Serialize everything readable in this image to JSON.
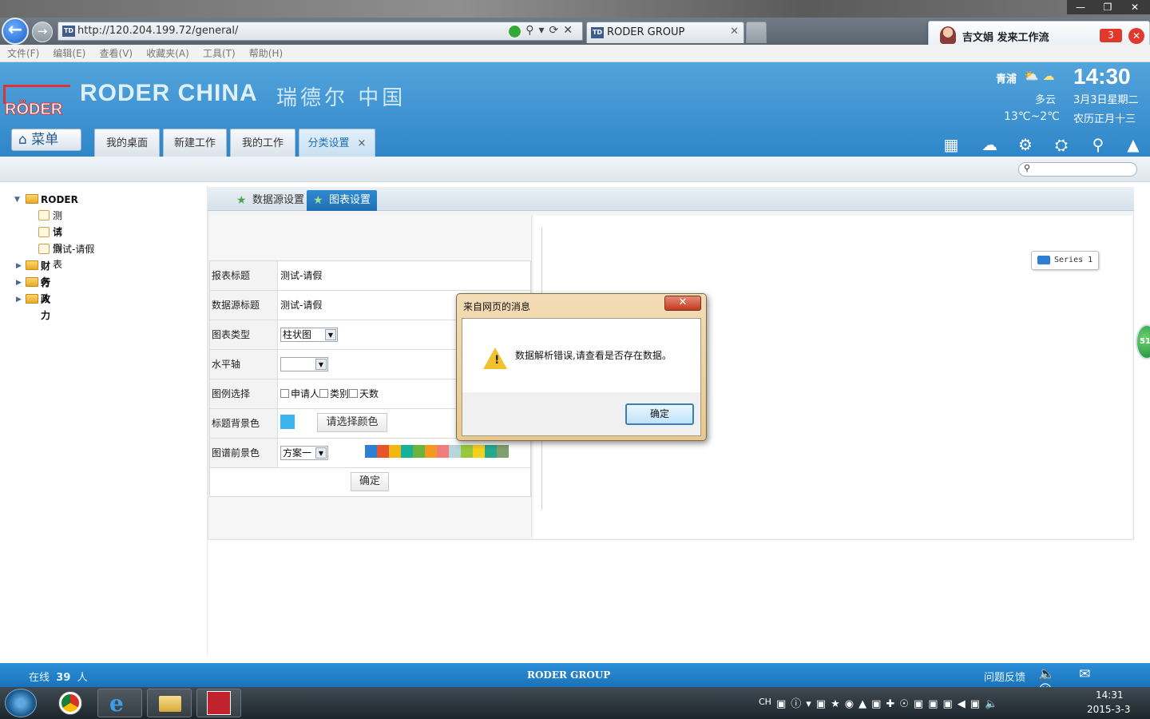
{
  "browser": {
    "url": "http://120.204.199.72/general/",
    "tab_title": "RODER GROUP",
    "favicon_label": "TD",
    "menu": [
      "文件(F)",
      "编辑(E)",
      "查看(V)",
      "收藏夹(A)",
      "工具(T)",
      "帮助(H)"
    ]
  },
  "notification": {
    "text": "吉文娟  发来工作流",
    "count": "3"
  },
  "header": {
    "logo_text": "RÖDER",
    "brand_en": "RODER CHINA",
    "brand_cn": "瑞德尔 中国",
    "weather": {
      "city": "青浦",
      "desc": "多云",
      "temp": "13℃~2℃"
    },
    "clock": {
      "time": "14:30",
      "date": "3月3日星期二",
      "lunar": "农历正月十三"
    },
    "menu_button": "菜单",
    "tabs": [
      "我的桌面",
      "新建工作",
      "我的工作",
      "分类设置"
    ],
    "active_tab": "分类设置",
    "icons": [
      "apps-icon",
      "help-cloud-icon",
      "settings-icon",
      "shirt-icon",
      "key-icon",
      "collapse-icon"
    ]
  },
  "sidebar": {
    "root": "RODER",
    "children": [
      "测试",
      "请假表",
      "测试-请假"
    ],
    "folders": [
      "财务",
      "行政",
      "人力"
    ]
  },
  "subtabs": [
    "数据源设置",
    "图表设置"
  ],
  "form": {
    "rows": [
      {
        "label": "报表标题",
        "value": "测试-请假"
      },
      {
        "label": "数据源标题",
        "value": "测试-请假"
      },
      {
        "label": "图表类型",
        "value": "柱状图"
      },
      {
        "label": "水平轴",
        "value": ""
      },
      {
        "label": "图例选择",
        "options": [
          "申请人",
          "类别",
          "天数"
        ]
      },
      {
        "label": "标题背景色",
        "button": "请选择颜色",
        "color": "#3cb4f0"
      },
      {
        "label": "图谱前景色",
        "value": "方案一"
      }
    ],
    "palette": [
      "#2e7fd4",
      "#e8542a",
      "#f2b713",
      "#16b19a",
      "#6bb33c",
      "#f29a1d",
      "#f27b7b",
      "#b6d6dc",
      "#9ac83b",
      "#f2d21e",
      "#26a88f",
      "#7fa06a"
    ],
    "submit": "确定"
  },
  "chart": {
    "legend": "Series 1",
    "side_badge": "51"
  },
  "dialog": {
    "title": "来自网页的消息",
    "message": "数据解析错误,请查看是否存在数据。",
    "ok": "确定"
  },
  "status": {
    "online_label": "在线",
    "online_count": "39",
    "online_unit": "人",
    "center": "RODER GROUP",
    "feedback": "问题反馈"
  },
  "taskbar": {
    "lang": "CH",
    "time": "14:31",
    "date": "2015-3-3"
  }
}
